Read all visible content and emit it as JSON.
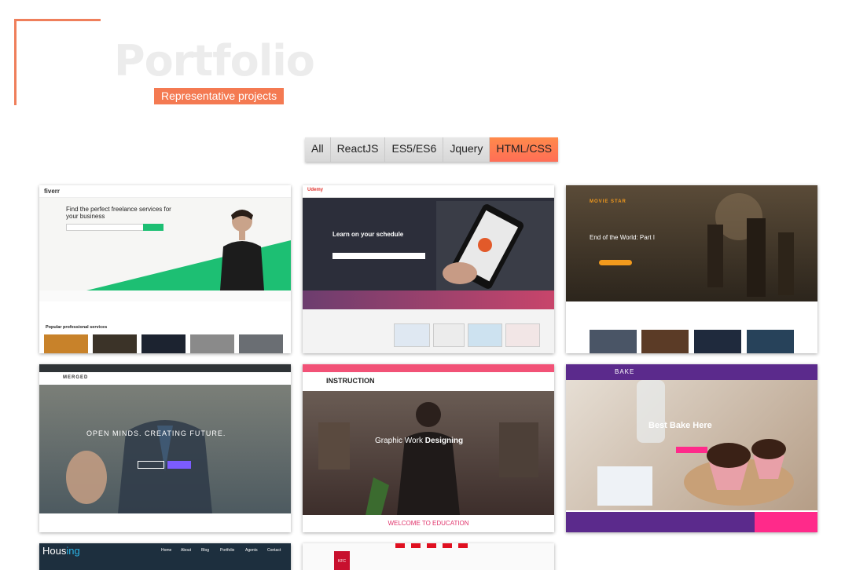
{
  "header": {
    "title": "Portfolio",
    "subtitle": "Representative projects"
  },
  "filters": [
    {
      "label": "All",
      "active": false
    },
    {
      "label": "ReactJS",
      "active": false
    },
    {
      "label": "ES5/ES6",
      "active": false
    },
    {
      "label": "Jquery",
      "active": false
    },
    {
      "label": "HTML/CSS",
      "active": true
    }
  ],
  "colors": {
    "accent": "#f47a52",
    "filter_active": "#ff7a50",
    "title": "#ececec"
  },
  "projects": [
    {
      "logo": "fiverr",
      "headline": "Find the perfect freelance services for your business",
      "section": "Popular professional services"
    },
    {
      "logo": "Udemy",
      "headline": "Learn on your schedule"
    },
    {
      "logo": "MOVIE STAR",
      "headline": "End of the World: Part I"
    },
    {
      "logo": "MERGED",
      "headline": "OPEN MINDS. CREATING FUTURE."
    },
    {
      "logo": "INSTRUCTION",
      "headline_regular": "Graphic Work",
      "headline_bold": "Designing",
      "footer": "WELCOME TO EDUCATION"
    },
    {
      "logo": "BAKE",
      "headline": "Best Bake Here"
    },
    {
      "logo_part1": "Hous",
      "logo_part2": "ing",
      "nav": [
        "Home",
        "About",
        "Blog",
        "Portfolio",
        "Agents",
        "Contact"
      ]
    },
    {
      "logo": "KFC"
    }
  ]
}
